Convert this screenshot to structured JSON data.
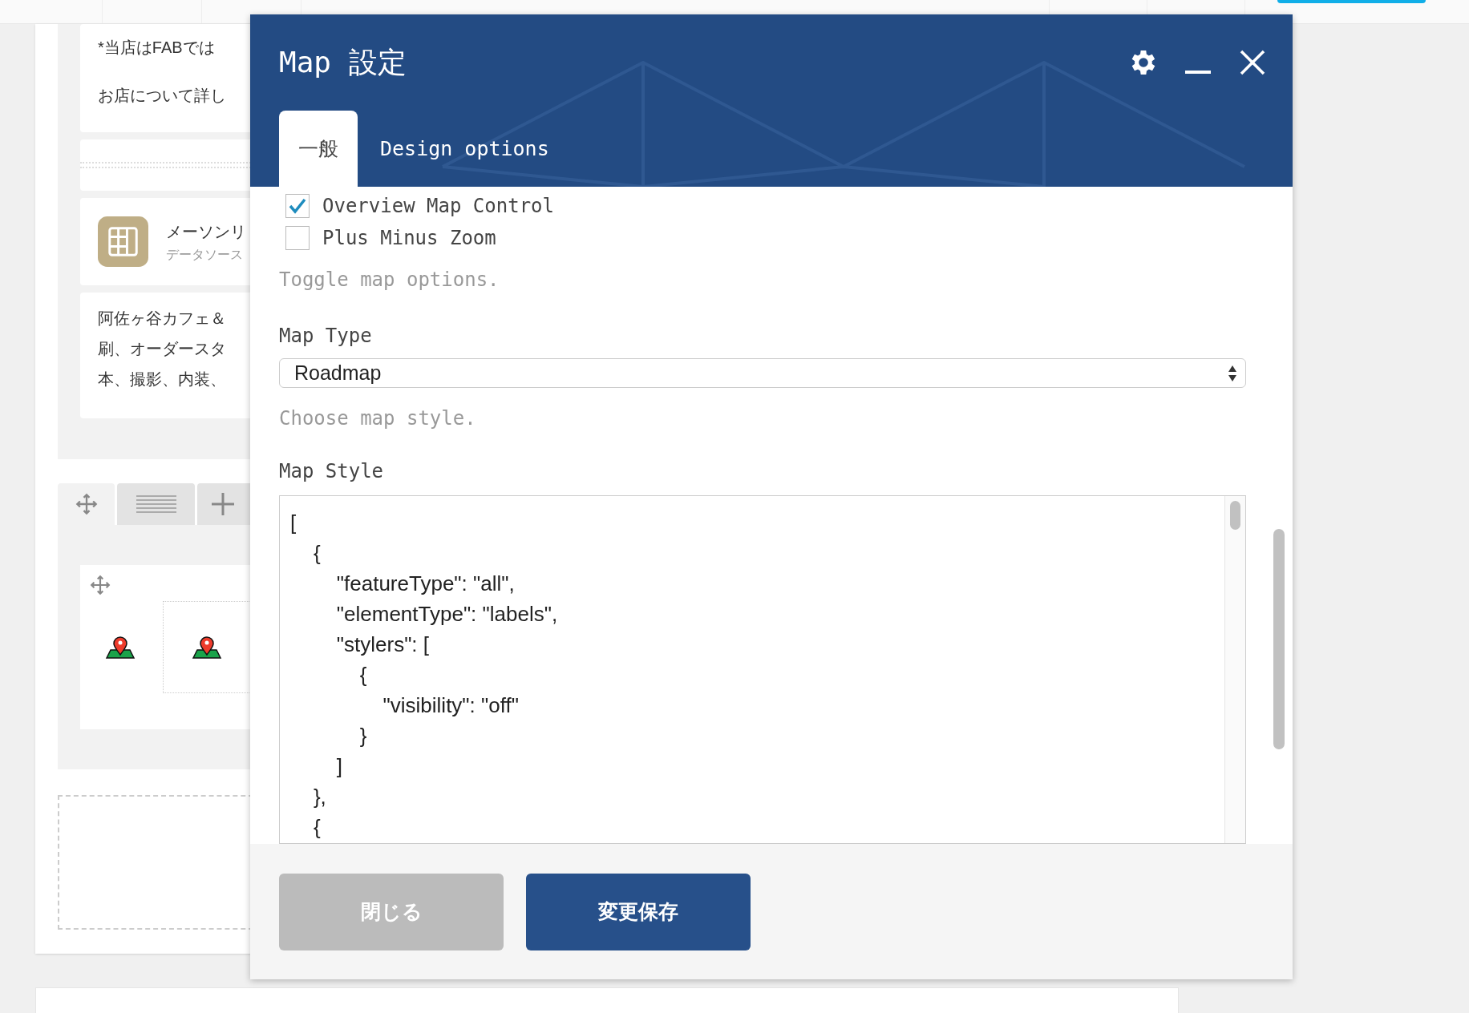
{
  "background": {
    "cards": [
      {
        "kind": "text",
        "lines": [
          "*当店はFABでは",
          "お店について詳し"
        ]
      },
      {
        "kind": "divider"
      },
      {
        "kind": "source",
        "title": "メーソンリ",
        "subtitle": "データソース"
      },
      {
        "kind": "text",
        "lines": [
          "阿佐ヶ谷カフェ＆",
          "刷、オーダースタ",
          "本、撮影、内装、"
        ]
      }
    ]
  },
  "dialog": {
    "title": "Map 設定",
    "tabs": [
      {
        "label": "一般",
        "selected": true
      },
      {
        "label": "Design options",
        "selected": false
      }
    ],
    "options": [
      {
        "label": "Overview Map Control",
        "checked": true
      },
      {
        "label": "Plus Minus Zoom",
        "checked": false
      }
    ],
    "options_help": "Toggle map options.",
    "map_type": {
      "label": "Map Type",
      "value": "Roadmap",
      "help": "Choose map style."
    },
    "map_style": {
      "label": "Map Style",
      "value": "[\n\t{\n\t\t\"featureType\": \"all\",\n\t\t\"elementType\": \"labels\",\n\t\t\"stylers\": [\n\t\t\t{\n\t\t\t\t\"visibility\": \"off\"\n\t\t\t}\n\t\t]\n\t},\n\t{"
    },
    "buttons": [
      {
        "label": "閉じる",
        "kind": "secondary"
      },
      {
        "label": "変更保存",
        "kind": "primary"
      }
    ]
  }
}
